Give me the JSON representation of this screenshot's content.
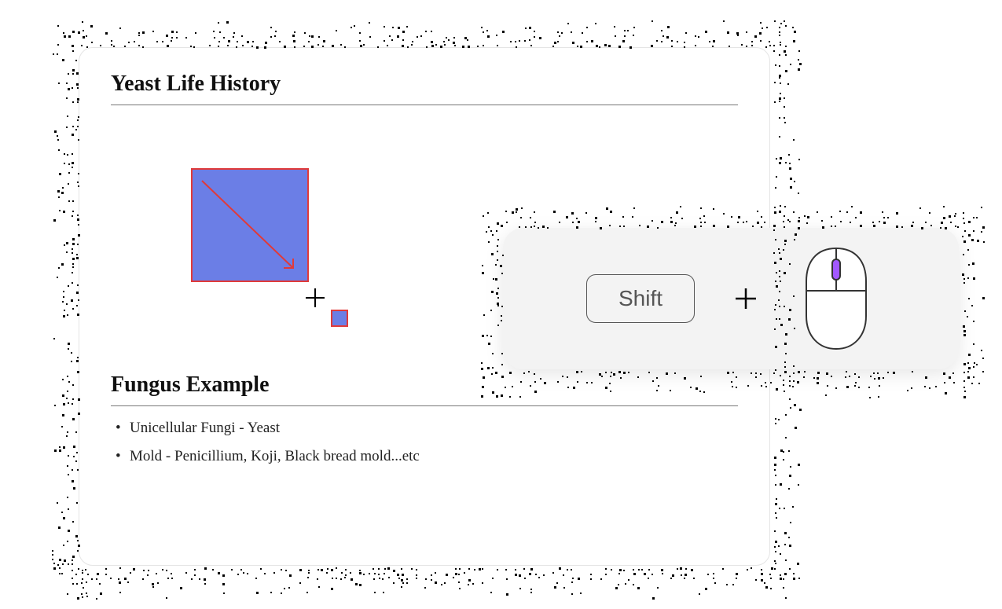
{
  "document": {
    "title": "Yeast Life History",
    "section_title": "Fungus Example",
    "bullets": [
      "Unicellular Fungi - Yeast",
      "Mold - Penicillium, Koji, Black bread mold...etc"
    ]
  },
  "shortcut": {
    "key_label": "Shift",
    "combiner_icon": "plus-icon",
    "device_icon": "mouse-icon"
  },
  "colors": {
    "shape_fill": "#6b7ee6",
    "shape_stroke": "#e03a3a",
    "tooltip_bg": "#f3f3f3",
    "mouse_accent": "#a259ff"
  }
}
